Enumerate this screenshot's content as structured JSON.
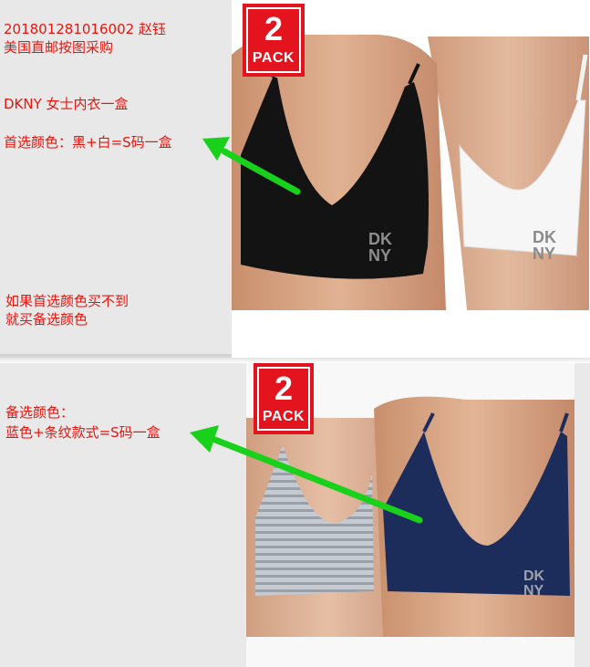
{
  "top": {
    "lines": [
      "201801281016002   赵钰",
      "美国直邮按图采购",
      "DKNY  女士内衣一盒",
      "首选颜色：黑+白=S码一盒",
      "如果首选颜色买不到",
      "就买备选颜色"
    ],
    "badge": {
      "number": "2",
      "label": "PACK"
    },
    "brand_logo": "DKNY"
  },
  "bottom": {
    "lines": [
      "备选颜色：",
      "蓝色+条纹款式=S码一盒"
    ],
    "badge": {
      "number": "2",
      "label": "PACK"
    },
    "brand_logo": "DKNY"
  },
  "colors": {
    "note_red": "#e8150e",
    "badge_red": "#e3141e",
    "arrow_green": "#19d11a",
    "bra_black": "#131313",
    "bra_white": "#f6f6f6",
    "bra_navy": "#1c2d5c",
    "bra_stripe_gray": "#b7bcc4",
    "skin": "#d7a585"
  }
}
